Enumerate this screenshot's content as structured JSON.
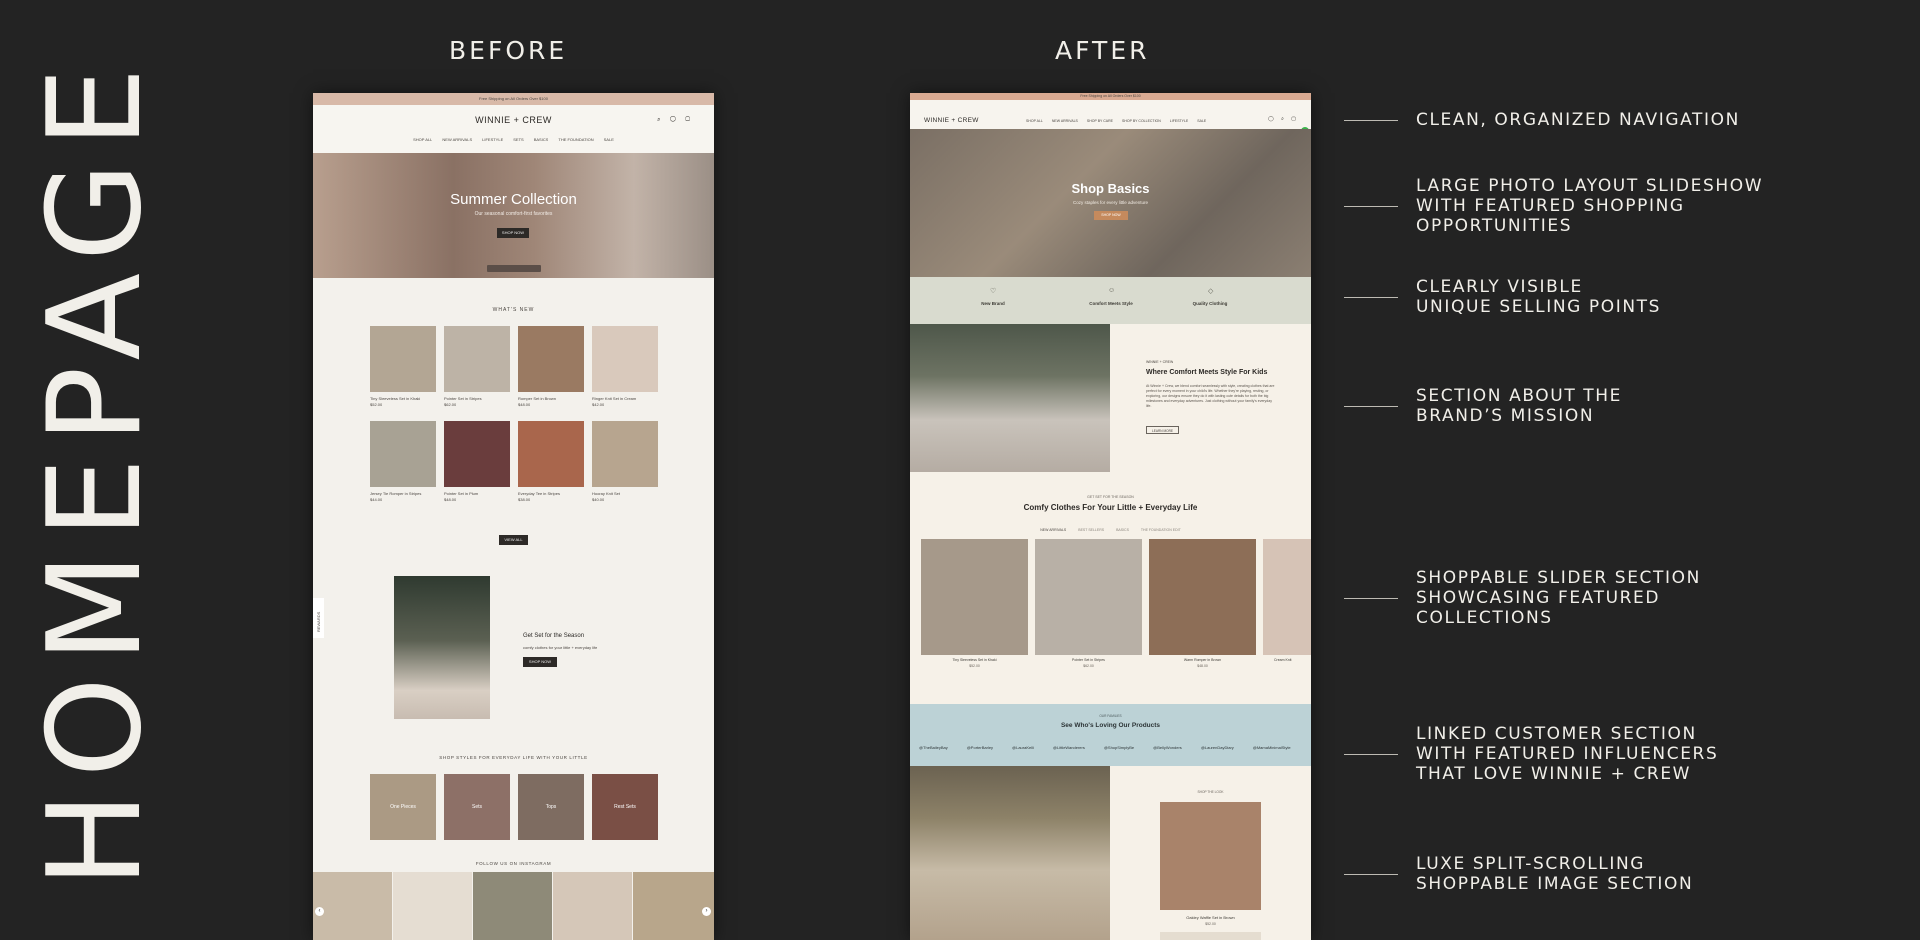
{
  "page_title": "HOMEPAGE",
  "before_label": "BEFORE",
  "after_label": "AFTER",
  "annotations": [
    "CLEAN, ORGANIZED NAVIGATION",
    "LARGE PHOTO LAYOUT SLIDESHOW\nWITH FEATURED SHOPPING\nOPPORTUNITIES",
    "CLEARLY VISIBLE\nUNIQUE SELLING POINTS",
    "SECTION ABOUT THE\nBRAND’S MISSION",
    "SHOPPABLE SLIDER SECTION\nSHOWCASING FEATURED\nCOLLECTIONS",
    "LINKED CUSTOMER SECTION\nWITH FEATURED INFLUENCERS\nTHAT LOVE WINNIE + CREW",
    "LUXE SPLIT-SCROLLING\nSHOPPABLE IMAGE SECTION"
  ],
  "before": {
    "announcement": "Free Shipping on All Orders Over $100",
    "brand": "WINNIE + CREW",
    "nav": [
      "SHOP ALL",
      "NEW ARRIVALS",
      "LIFESTYLE",
      "SETS",
      "BASICS",
      "THE FOUNDATION",
      "SALE"
    ],
    "hero_title": "Summer Collection",
    "hero_subtitle": "Our seasonal comfort-first favorites",
    "hero_button": "SHOP NOW",
    "whats_new": "WHAT'S NEW",
    "products": [
      {
        "name": "Tiny Sleeveless Set in Khaki",
        "price": "$52.00",
        "color": "#b3a694"
      },
      {
        "name": "Pointer Set in Stripes",
        "price": "$62.00",
        "color": "#bdb3a6"
      },
      {
        "name": "Romper Set in Brown",
        "price": "$48.00",
        "color": "#9a7a62"
      },
      {
        "name": "Ringer Knit Set in Cream",
        "price": "$42.00",
        "color": "#d9c9bc"
      },
      {
        "name": "Jersey Tie Romper in Stripes",
        "price": "$44.00",
        "color": "#a8a294"
      },
      {
        "name": "Pointer Set in Plum",
        "price": "$48.00",
        "color": "#6a3d3d"
      },
      {
        "name": "Everyday Tee in Stripes",
        "price": "$38.00",
        "color": "#a9664c"
      },
      {
        "name": "Hooray Knit Set",
        "price": "$40.00",
        "color": "#b7a58f"
      }
    ],
    "view_all": "VIEW ALL",
    "sidebar_tab": "REWARDS",
    "feature_title": "Get Set for the Season",
    "feature_subtitle": "comfy clothes for your little + everyday life",
    "feature_button": "SHOP NOW",
    "styles_heading": "SHOP STYLES FOR EVERYDAY LIFE WITH YOUR LITTLE",
    "styles": [
      {
        "label": "One Pieces",
        "color": "#ab9a84"
      },
      {
        "label": "Sets",
        "color": "#8d7067"
      },
      {
        "label": "Tops",
        "color": "#7e6c61"
      },
      {
        "label": "Rest Sets",
        "color": "#7a4f45"
      }
    ],
    "instagram_heading": "FOLLOW US ON INSTAGRAM",
    "instagram_colors": [
      "#c9bba8",
      "#e5ddd2",
      "#8e8a78",
      "#d5c7b8",
      "#b8a68b"
    ]
  },
  "after": {
    "announcement": "Free Shipping on All Orders Over $100",
    "brand": "WINNIE + CREW",
    "nav": [
      "SHOP ALL",
      "NEW ARRIVALS",
      "SHOP BY CARE",
      "SHOP BY COLLECTION",
      "LIFESTYLE",
      "SALE"
    ],
    "hero_title": "Shop Basics",
    "hero_subtitle": "Cozy staples for every little adventure",
    "hero_button": "SHOP NOW",
    "usps": [
      "New Brand",
      "Comfort Meets Style",
      "Quality Clothing"
    ],
    "mission_eyebrow": "WINNIE + CREW",
    "mission_title": "Where Comfort Meets Style For Kids",
    "mission_body": "At Winnie + Crew, we blend comfort seamlessly with style, creating clothes that are perfect for every moment in your child's life. Whether they're playing, resting, or exploring, our designs ensure they do it with lasting cute details for both the big milestones and everyday adventures. Just clothing without your family's everyday life.",
    "mission_button": "LEARN MORE",
    "slider_eyebrow": "GET SET FOR THE SEASON",
    "slider_title": "Comfy Clothes For Your Little + Everyday Life",
    "slider_tabs": [
      "NEW ARRIVALS",
      "BEST SELLERS",
      "BASICS",
      "THE FOUNDATION EDIT"
    ],
    "slider_products": [
      {
        "name": "Tiny Sleeveless Set in Khaki",
        "price": "$52.00",
        "color": "#a6998a"
      },
      {
        "name": "Pointer Set in Stripes",
        "price": "$62.00",
        "color": "#b8b0a6"
      },
      {
        "name": "Warm Romper in Brown",
        "price": "$48.00",
        "color": "#8d6e57"
      },
      {
        "name": "Cream Knit",
        "price": "",
        "color": "#d6c3b6"
      }
    ],
    "love_eyebrow": "OUR FAMILIES",
    "love_title": "See Who's Loving Our Products",
    "love_handles": [
      "@TheBaileyBay",
      "@PorterBarley",
      "@LauraKelli",
      "@LittleWanderers",
      "@ShopSimplyBe",
      "@BellyWonders",
      "@LaurenDayDiary",
      "@MamaMinimalStyle"
    ],
    "split_eyebrow": "SHOP THE LOOK",
    "split_product_name": "Oakley Waffle Set in Brown",
    "split_product_price": "$52.00"
  }
}
